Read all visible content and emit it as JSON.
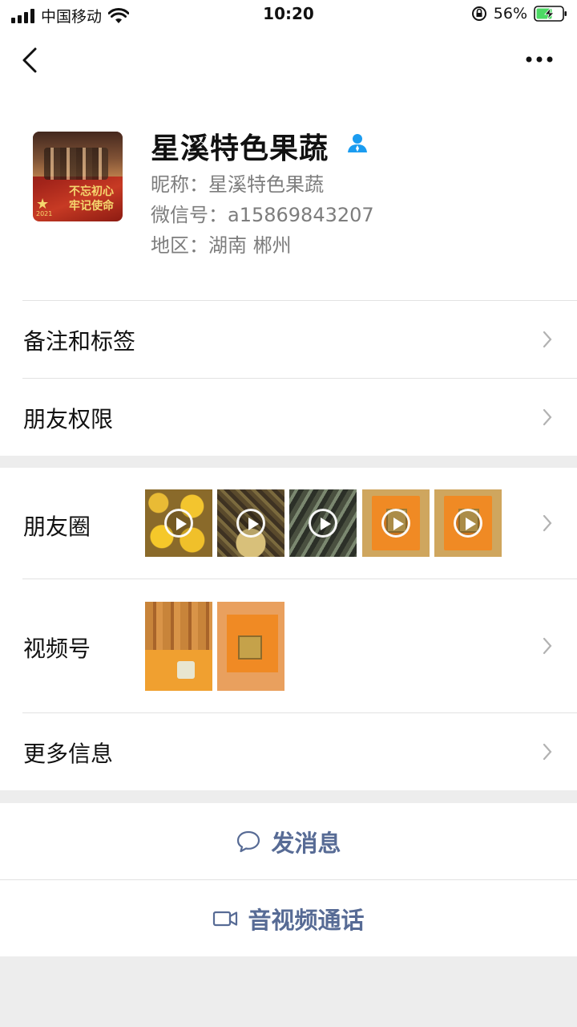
{
  "status_bar": {
    "carrier": "中国移动",
    "time": "10:20",
    "battery_percent": "56%",
    "icons": [
      "signal-icon",
      "wifi-icon",
      "rotation-lock-icon",
      "battery-charging-icon"
    ]
  },
  "nav": {
    "back_icon": "chevron-left-icon",
    "more_icon": "more-dots-icon"
  },
  "profile": {
    "name": "星溪特色果蔬",
    "nickname": "昵称：星溪特色果蔬",
    "wechat_id": "微信号：a15869843207",
    "region": "地区：湖南 郴州",
    "avatar_text_line1": "不忘初心",
    "avatar_text_line2": "牢记使命",
    "avatar_year": "2021"
  },
  "rows": {
    "remarks_tags": "备注和标签",
    "friend_permissions": "朋友权限",
    "moments": "朋友圈",
    "channels": "视频号",
    "more_info": "更多信息"
  },
  "moments_thumbs": [
    {
      "kind": "oranges",
      "video": true
    },
    {
      "kind": "harvest",
      "video": true
    },
    {
      "kind": "orchard",
      "video": true
    },
    {
      "kind": "box",
      "video": true
    },
    {
      "kind": "box",
      "video": true
    }
  ],
  "actions": {
    "send_message": "发消息",
    "av_call": "音视频通话"
  },
  "colors": {
    "link_blue": "#576b95",
    "background": "#ededed",
    "verified_icon": "#1b9cf0"
  }
}
